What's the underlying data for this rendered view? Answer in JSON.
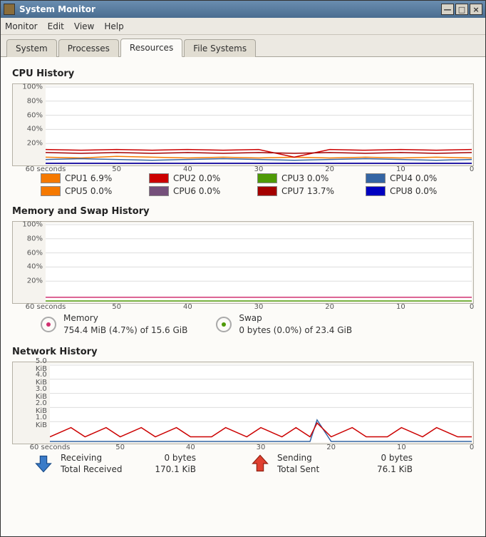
{
  "window": {
    "title": "System Monitor"
  },
  "menu": {
    "items": [
      "Monitor",
      "Edit",
      "View",
      "Help"
    ]
  },
  "tabs": [
    "System",
    "Processes",
    "Resources",
    "File Systems"
  ],
  "active_tab": 2,
  "cpu": {
    "title": "CPU History",
    "y_ticks": [
      "100%",
      "80%",
      "60%",
      "40%",
      "20%"
    ],
    "x_ticks": [
      "60 seconds",
      "50",
      "40",
      "30",
      "20",
      "10",
      "0"
    ],
    "legend": [
      {
        "name": "CPU1",
        "value": "6.9%",
        "color": "#f57900"
      },
      {
        "name": "CPU2",
        "value": "0.0%",
        "color": "#cc0000"
      },
      {
        "name": "CPU3",
        "value": "0.0%",
        "color": "#4e9a06"
      },
      {
        "name": "CPU4",
        "value": "0.0%",
        "color": "#3465a4"
      },
      {
        "name": "CPU5",
        "value": "0.0%",
        "color": "#f57900"
      },
      {
        "name": "CPU6",
        "value": "0.0%",
        "color": "#75507b"
      },
      {
        "name": "CPU7",
        "value": "13.7%",
        "color": "#a40000"
      },
      {
        "name": "CPU8",
        "value": "0.0%",
        "color": "#0000c0"
      }
    ]
  },
  "memory": {
    "title": "Memory and Swap History",
    "y_ticks": [
      "100%",
      "80%",
      "60%",
      "40%",
      "20%"
    ],
    "x_ticks": [
      "60 seconds",
      "50",
      "40",
      "30",
      "20",
      "10",
      "0"
    ],
    "mem_label": "Memory",
    "mem_text": "754.4 MiB (4.7%) of 15.6 GiB",
    "swap_label": "Swap",
    "swap_text": "0 bytes (0.0%) of 23.4 GiB",
    "mem_color": "#d03070",
    "swap_color": "#4e9a06"
  },
  "network": {
    "title": "Network History",
    "y_ticks": [
      "5.0 KiB",
      "4.0 KiB",
      "3.0 KiB",
      "2.0 KiB",
      "1.0 KiB"
    ],
    "x_ticks": [
      "60 seconds",
      "50",
      "40",
      "30",
      "20",
      "10",
      "0"
    ],
    "recv_label": "Receiving",
    "recv_value": "0 bytes",
    "recv_total_label": "Total Received",
    "recv_total": "170.1 KiB",
    "send_label": "Sending",
    "send_value": "0 bytes",
    "send_total_label": "Total Sent",
    "send_total": "76.1 KiB",
    "recv_color": "#3465a4",
    "send_color": "#cc0000"
  },
  "chart_data": [
    {
      "type": "line",
      "title": "CPU History",
      "xlabel": "seconds",
      "ylabel": "%",
      "ylim": [
        0,
        100
      ],
      "xlim": [
        60,
        0
      ],
      "x": [
        60,
        55,
        50,
        45,
        40,
        35,
        30,
        25,
        20,
        15,
        10,
        5,
        0
      ],
      "series": [
        {
          "name": "CPU1",
          "color": "#f57900",
          "values": [
            8,
            7,
            9,
            8,
            7,
            8,
            7,
            8,
            7,
            8,
            7,
            8,
            7
          ]
        },
        {
          "name": "CPU2",
          "color": "#cc0000",
          "values": [
            18,
            17,
            18,
            17,
            18,
            17,
            18,
            8,
            18,
            17,
            18,
            17,
            18
          ]
        },
        {
          "name": "CPU3",
          "color": "#4e9a06",
          "values": [
            0,
            0,
            0,
            0,
            0,
            0,
            0,
            0,
            0,
            0,
            0,
            0,
            0
          ]
        },
        {
          "name": "CPU4",
          "color": "#3465a4",
          "values": [
            5,
            6,
            5,
            4,
            5,
            6,
            5,
            4,
            5,
            6,
            5,
            4,
            5
          ]
        },
        {
          "name": "CPU5",
          "color": "#f57900",
          "values": [
            0,
            0,
            0,
            0,
            0,
            0,
            0,
            0,
            0,
            0,
            0,
            0,
            0
          ]
        },
        {
          "name": "CPU6",
          "color": "#75507b",
          "values": [
            0,
            0,
            0,
            0,
            0,
            0,
            0,
            0,
            0,
            0,
            0,
            0,
            0
          ]
        },
        {
          "name": "CPU7",
          "color": "#a40000",
          "values": [
            14,
            13,
            14,
            13,
            14,
            13,
            14,
            13,
            14,
            13,
            14,
            13,
            14
          ]
        },
        {
          "name": "CPU8",
          "color": "#0000c0",
          "values": [
            0,
            0,
            0,
            0,
            0,
            0,
            0,
            0,
            0,
            0,
            0,
            0,
            0
          ]
        }
      ]
    },
    {
      "type": "line",
      "title": "Memory and Swap History",
      "xlabel": "seconds",
      "ylabel": "%",
      "ylim": [
        0,
        100
      ],
      "xlim": [
        60,
        0
      ],
      "x": [
        60,
        0
      ],
      "series": [
        {
          "name": "Memory",
          "color": "#d03070",
          "values": [
            4.7,
            4.7
          ]
        },
        {
          "name": "Swap",
          "color": "#4e9a06",
          "values": [
            0,
            0
          ]
        }
      ]
    },
    {
      "type": "line",
      "title": "Network History",
      "xlabel": "seconds",
      "ylabel": "KiB",
      "ylim": [
        0,
        5
      ],
      "xlim": [
        60,
        0
      ],
      "x": [
        60,
        57,
        55,
        52,
        50,
        47,
        45,
        42,
        40,
        37,
        35,
        32,
        30,
        27,
        25,
        23,
        22,
        20,
        17,
        15,
        12,
        10,
        7,
        5,
        2,
        0
      ],
      "series": [
        {
          "name": "Receiving",
          "color": "#3465a4",
          "values": [
            0,
            0,
            0,
            0,
            0,
            0,
            0,
            0,
            0,
            0,
            0,
            0,
            0,
            0,
            0,
            0,
            1.4,
            0,
            0,
            0,
            0,
            0,
            0,
            0,
            0,
            0
          ]
        },
        {
          "name": "Sending",
          "color": "#cc0000",
          "values": [
            0.3,
            0.9,
            0.3,
            0.9,
            0.3,
            0.9,
            0.3,
            0.9,
            0.3,
            0.3,
            0.9,
            0.3,
            0.9,
            0.3,
            0.9,
            0.3,
            1.2,
            0.3,
            0.9,
            0.3,
            0.3,
            0.9,
            0.3,
            0.9,
            0.3,
            0.3
          ]
        }
      ]
    }
  ]
}
